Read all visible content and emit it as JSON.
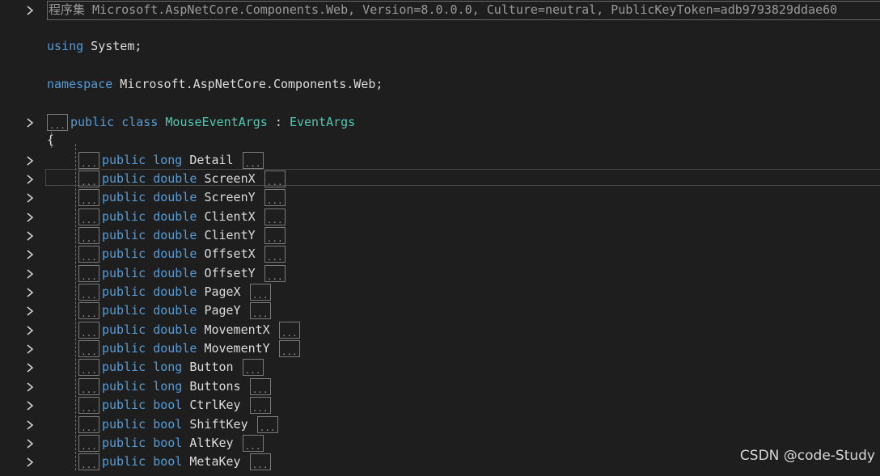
{
  "header": {
    "text": "程序集 Microsoft.AspNetCore.Components.Web, Version=8.0.0.0, Culture=neutral, PublicKeyToken=adb9793829ddae60"
  },
  "using_line": {
    "keyword": "using",
    "rest": " System;"
  },
  "namespace_line": {
    "keyword": "namespace",
    "rest": " Microsoft.AspNetCore.Components.Web;"
  },
  "class_line": {
    "fold": "...",
    "kw1": "public",
    "kw2": "class",
    "name": "MouseEventArgs",
    "sep": " : ",
    "base": "EventArgs"
  },
  "open_brace": "{",
  "members": [
    {
      "access": "public",
      "type": "long",
      "name": "Detail"
    },
    {
      "access": "public",
      "type": "double",
      "name": "ScreenX"
    },
    {
      "access": "public",
      "type": "double",
      "name": "ScreenY"
    },
    {
      "access": "public",
      "type": "double",
      "name": "ClientX"
    },
    {
      "access": "public",
      "type": "double",
      "name": "ClientY"
    },
    {
      "access": "public",
      "type": "double",
      "name": "OffsetX"
    },
    {
      "access": "public",
      "type": "double",
      "name": "OffsetY"
    },
    {
      "access": "public",
      "type": "double",
      "name": "PageX"
    },
    {
      "access": "public",
      "type": "double",
      "name": "PageY"
    },
    {
      "access": "public",
      "type": "double",
      "name": "MovementX"
    },
    {
      "access": "public",
      "type": "double",
      "name": "MovementY"
    },
    {
      "access": "public",
      "type": "long",
      "name": "Button"
    },
    {
      "access": "public",
      "type": "long",
      "name": "Buttons"
    },
    {
      "access": "public",
      "type": "bool",
      "name": "CtrlKey"
    },
    {
      "access": "public",
      "type": "bool",
      "name": "ShiftKey"
    },
    {
      "access": "public",
      "type": "bool",
      "name": "AltKey"
    },
    {
      "access": "public",
      "type": "bool",
      "name": "MetaKey"
    }
  ],
  "fold_marker": "...",
  "icons": {
    "expand": "chevron-right-icon"
  },
  "colors": {
    "background": "#1e1e1e",
    "keyword": "#569cd6",
    "type": "#4ec9b0",
    "text": "#dcdcdc"
  },
  "watermark": "CSDN @code-Study"
}
